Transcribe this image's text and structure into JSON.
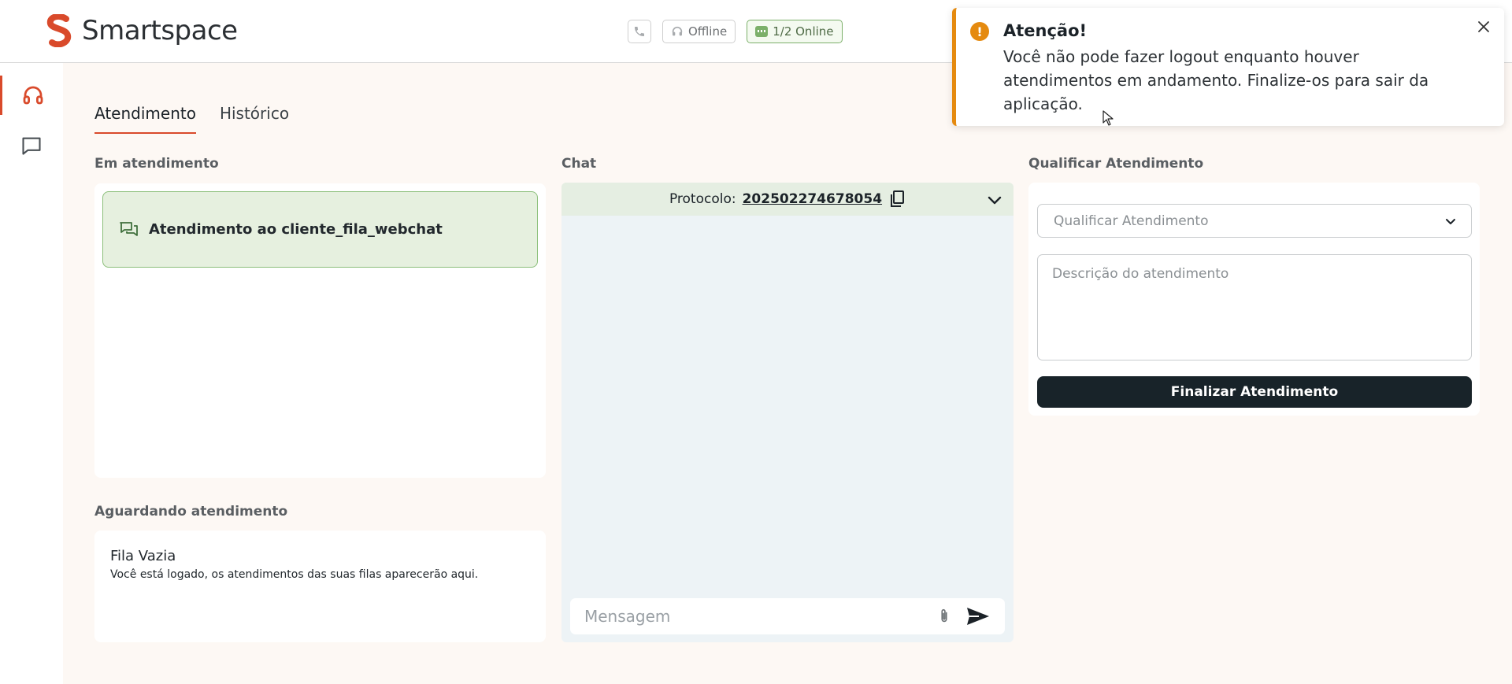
{
  "brand": {
    "name": "Smartspace",
    "accent": "#d94a2b"
  },
  "status": {
    "voice_label": "Offline",
    "chat_label": "1/2 Online"
  },
  "tabs": [
    {
      "label": "Atendimento"
    },
    {
      "label": "Histórico"
    }
  ],
  "sections": {
    "in_service": "Em atendimento",
    "waiting": "Aguardando atendimento",
    "chat": "Chat",
    "qualify": "Qualificar Atendimento"
  },
  "in_service_items": [
    {
      "label": "Atendimento ao cliente_fila_webchat"
    }
  ],
  "waiting_queue": {
    "title": "Fila Vazia",
    "description": "Você está logado, os atendimentos das suas filas aparecerão aqui."
  },
  "chat": {
    "protocol_label": "Protocolo:",
    "protocol_number": "202502274678054",
    "message_placeholder": "Mensagem"
  },
  "qualify": {
    "select_placeholder": "Qualificar Atendimento",
    "description_placeholder": "Descrição do atendimento",
    "finish_label": "Finalizar Atendimento"
  },
  "toast": {
    "title": "Atenção!",
    "message": "Você não pode fazer logout enquanto houver atendimentos em andamento. Finalize-os para sair da aplicação.",
    "icon": "!",
    "color": "#e58a0f"
  }
}
